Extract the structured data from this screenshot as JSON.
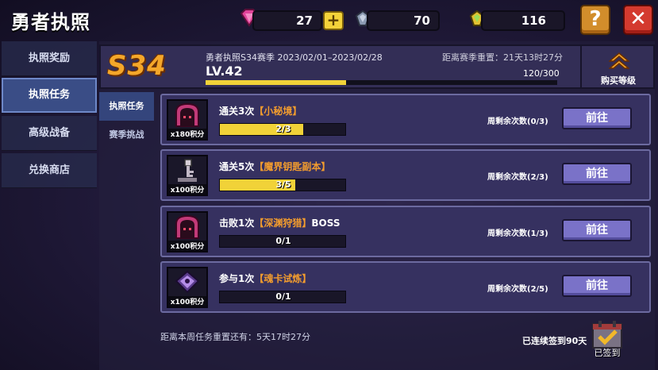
{
  "header": {
    "title": "勇者执照",
    "gems": "27",
    "crystal": "70",
    "gold_crystal": "116",
    "help_label": "?",
    "close_label": "✕",
    "plus_label": "+"
  },
  "nav": {
    "items": [
      {
        "label": "执照奖励"
      },
      {
        "label": "执照任务"
      },
      {
        "label": "高级战备"
      },
      {
        "label": "兑换商店"
      }
    ],
    "active_index": 1
  },
  "season": {
    "badge": "S34",
    "name": "勇者执照S34赛季 2023/02/01–2023/02/28",
    "countdown": "距离赛季重置：21天13时27分",
    "level": "LV.42",
    "xp": "120/300",
    "xp_fraction": 0.4,
    "buy_level_label": "购买等级"
  },
  "subtabs": [
    {
      "label": "执照任务"
    },
    {
      "label": "赛季挑战"
    }
  ],
  "tasks": [
    {
      "prefix": "通关3次",
      "highlight": "【小秘境】",
      "suffix": "",
      "icon": "monster-portal-icon",
      "points": "x180积分",
      "progress": "2/3",
      "progress_fraction": 0.667,
      "weekly": "周剩余次数(0/3)",
      "button": "前往"
    },
    {
      "prefix": "通关5次",
      "highlight": "【魔界钥匙副本】",
      "suffix": "",
      "icon": "key-icon",
      "points": "x100积分",
      "progress": "3/5",
      "progress_fraction": 0.6,
      "weekly": "周剩余次数(2/3)",
      "button": "前往"
    },
    {
      "prefix": "击败1次",
      "highlight": "【深渊狩猎】",
      "suffix": "BOSS",
      "icon": "monster-portal-icon",
      "points": "x100积分",
      "progress": "0/1",
      "progress_fraction": 0,
      "weekly": "周剩余次数(1/3)",
      "button": "前往"
    },
    {
      "prefix": "参与1次",
      "highlight": "【魂卡试炼】",
      "suffix": "",
      "icon": "soul-card-icon",
      "points": "x100积分",
      "progress": "0/1",
      "progress_fraction": 0,
      "weekly": "周剩余次数(2/5)",
      "button": "前往"
    }
  ],
  "footer": {
    "reset": "距离本周任务重置还有：5天17时27分",
    "signin_days": "已连续签到90天",
    "signin_button": "已签到"
  },
  "colors": {
    "accent_yellow": "#f1d238",
    "highlight_orange": "#f29c2e",
    "button_purple": "#7a72c8",
    "close_red": "#d43a2f",
    "help_orange": "#d28d2b"
  }
}
